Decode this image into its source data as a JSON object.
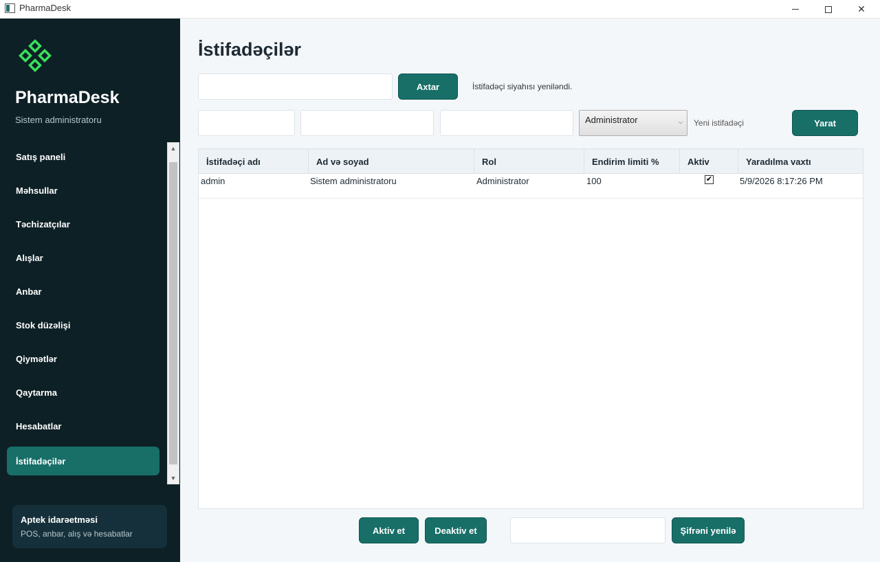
{
  "window": {
    "title": "PharmaDesk"
  },
  "sidebar": {
    "brand": "PharmaDesk",
    "subtitle": "Sistem administratoru",
    "items": [
      {
        "label": "Satış paneli"
      },
      {
        "label": "Məhsullar"
      },
      {
        "label": "Təchizatçılar"
      },
      {
        "label": "Alışlar"
      },
      {
        "label": "Anbar"
      },
      {
        "label": "Stok düzəlişi"
      },
      {
        "label": "Qiymətlər"
      },
      {
        "label": "Qaytarma"
      },
      {
        "label": "Hesabatlar"
      },
      {
        "label": "İstifadəçilər",
        "active": true
      }
    ],
    "info": {
      "title": "Aptek idarəetməsi",
      "subtitle": "POS, anbar, alış və hesabatlar"
    }
  },
  "main": {
    "title": "İstifadəçilər",
    "search": {
      "value": "",
      "placeholder": "",
      "button": "Axtar",
      "status": "İstifadəçi siyahısı yeniləndi."
    },
    "create": {
      "role_selected": "Administrator",
      "hint": "Yeni istifadəçi",
      "button": "Yarat"
    },
    "table": {
      "columns": [
        "İstifadəçi adı",
        "Ad və soyad",
        "Rol",
        "Endirim limiti %",
        "Aktiv",
        "Yaradılma vaxtı"
      ],
      "rows": [
        {
          "username": "admin",
          "full_name": "Sistem administratoru",
          "role": "Administrator",
          "discount": "100",
          "active": true,
          "created": "5/9/2026 8:17:26 PM"
        }
      ]
    },
    "actions": {
      "activate": "Aktiv et",
      "deactivate": "Deaktiv et",
      "reset_password": "Şifrəni yenilə"
    }
  },
  "colors": {
    "sidebar": "#0d2026",
    "accent": "#176f68",
    "logo": "#39e05a"
  },
  "icons": {
    "app": "app-window-icon",
    "logo": "pharma-diamond-logo-icon"
  }
}
